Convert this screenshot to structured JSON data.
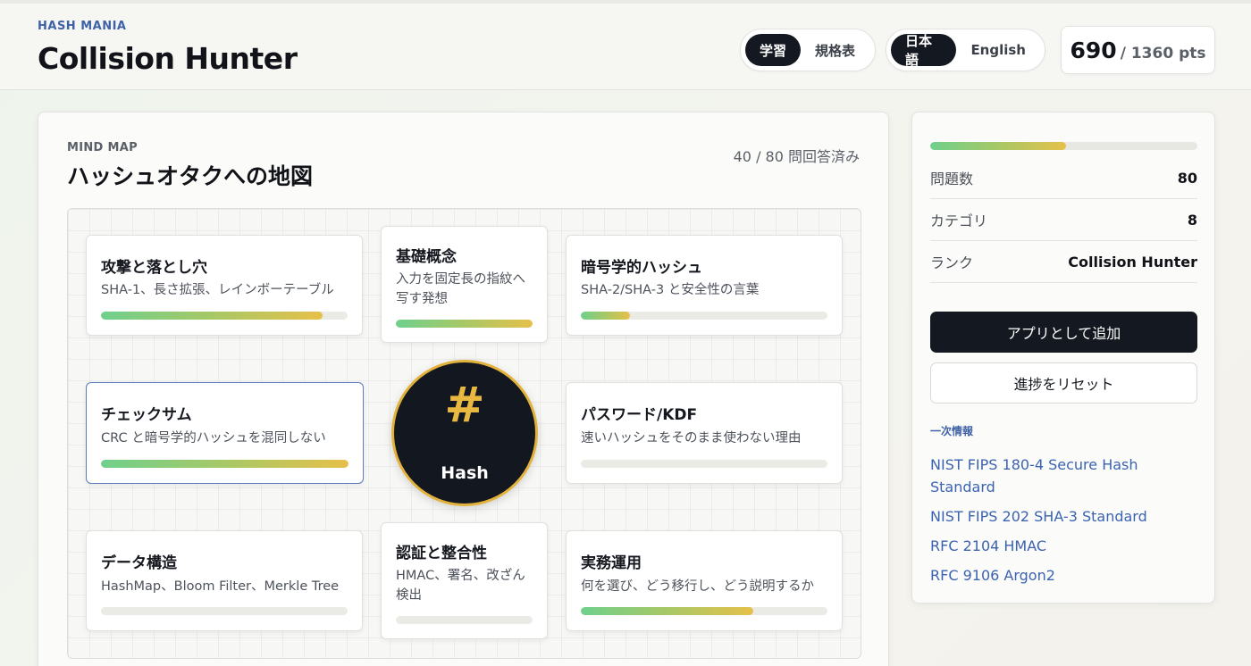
{
  "header": {
    "brand": "HASH MANIA",
    "title": "Collision Hunter",
    "mode_tabs": [
      "学習",
      "規格表"
    ],
    "lang_tabs": [
      "日本語",
      "English"
    ],
    "score": "690",
    "score_total": "/ 1360 pts"
  },
  "main": {
    "label": "MIND MAP",
    "title": "ハッシュオタクへの地図",
    "answered": "40 / 80 問回答済み",
    "hub": {
      "icon": "#",
      "label": "Hash",
      "icon_name": "hash-icon"
    },
    "nodes": [
      {
        "title": "攻撃と落とし穴",
        "desc": "SHA-1、長さ拡張、レインボーテーブル",
        "progress": 0.9
      },
      {
        "title": "基礎概念",
        "desc": "入力を固定長の指紋へ写す発想",
        "progress": 1.0
      },
      {
        "title": "暗号学的ハッシュ",
        "desc": "SHA-2/SHA-3 と安全性の言葉",
        "progress": 0.2
      },
      {
        "title": "チェックサム",
        "desc": "CRC と暗号学的ハッシュを混同しない",
        "progress": 1.0
      },
      {
        "title": "パスワード/KDF",
        "desc": "速いハッシュをそのまま使わない理由",
        "progress": 0.0
      },
      {
        "title": "データ構造",
        "desc": "HashMap、Bloom Filter、Merkle Tree",
        "progress": 0.0
      },
      {
        "title": "認証と整合性",
        "desc": "HMAC、署名、改ざん検出",
        "progress": 0.0
      },
      {
        "title": "実務運用",
        "desc": "何を選び、どう移行し、どう説明するか",
        "progress": 0.7
      }
    ]
  },
  "side": {
    "progress": 0.51,
    "stats": [
      {
        "label": "問題数",
        "value": "80"
      },
      {
        "label": "カテゴリ",
        "value": "8"
      },
      {
        "label": "ランク",
        "value": "Collision Hunter"
      }
    ],
    "add_app": "アプリとして追加",
    "reset": "進捗をリセット",
    "sources_label": "一次情報",
    "sources": [
      "NIST FIPS 180-4 Secure Hash Standard",
      "NIST FIPS 202 SHA-3 Standard",
      "RFC 2104 HMAC",
      "RFC 9106 Argon2"
    ]
  },
  "colors": {
    "accent_blue": "#3f62a6",
    "dark": "#141820",
    "gold": "#e3b23c",
    "progress_start": "#6fd08c",
    "progress_end": "#e6c04a"
  }
}
